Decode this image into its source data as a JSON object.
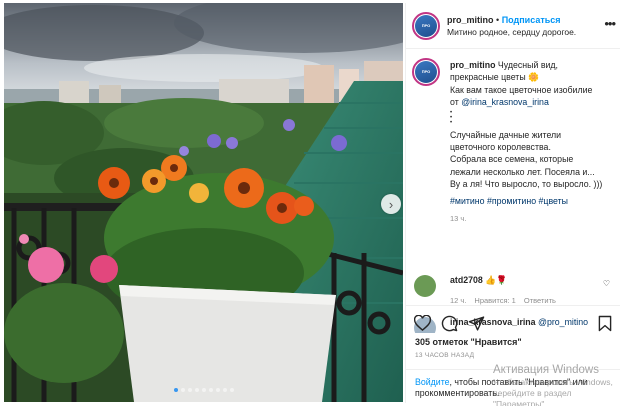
{
  "post": {
    "username": "pro_mitino",
    "follow_label": "Подписаться",
    "bullet": "•",
    "subtitle": "Митино родное, сердцу дорогое.",
    "caption_lines": "Чудесный вид,\nпрекрасные цветы 🌼\nКак вам такое цветочное изобилие\nот ",
    "caption_mention": "@irina_krasnova_irina",
    "caption_dots": "•\n•\n•",
    "caption_text": "Случайные дачные жители\nцветочного королевства.\nСобрала все семена, которые\nлежали несколько лет. Посеяла и...\nВу а ля! Что выросло, то выросло. )))",
    "hashtags": "#митино #промитино #цветы",
    "caption_time": "13 ч."
  },
  "comments": [
    {
      "username": "atd2708",
      "text": "👍🌹",
      "time": "12 ч.",
      "likes": "Нравится: 1",
      "reply": "Ответить"
    },
    {
      "username": "irina_krasnova_irina",
      "mention": "@pro_mitino"
    }
  ],
  "actions": {
    "likes": "305 отметок \"Нравится\"",
    "ago": "13 ЧАСОВ НАЗАД",
    "login_link": "Войдите",
    "login_text": ", чтобы поставить \"Нравится\" или прокомментировать."
  },
  "watermark": {
    "line1": "Активация Windows",
    "line2": "Чтобы активировать Windows,",
    "line3": "перейдите в раздел \"Параметры\"."
  },
  "icons": [
    "heart-icon",
    "comment-icon",
    "share-icon",
    "bookmark-icon",
    "more-icon",
    "next-arrow-icon"
  ],
  "colors": {
    "link": "#0095f6",
    "mention": "#00376b",
    "muted": "#8e8e8e",
    "text": "#262626"
  },
  "carousel": {
    "count": 9,
    "active": 1
  }
}
